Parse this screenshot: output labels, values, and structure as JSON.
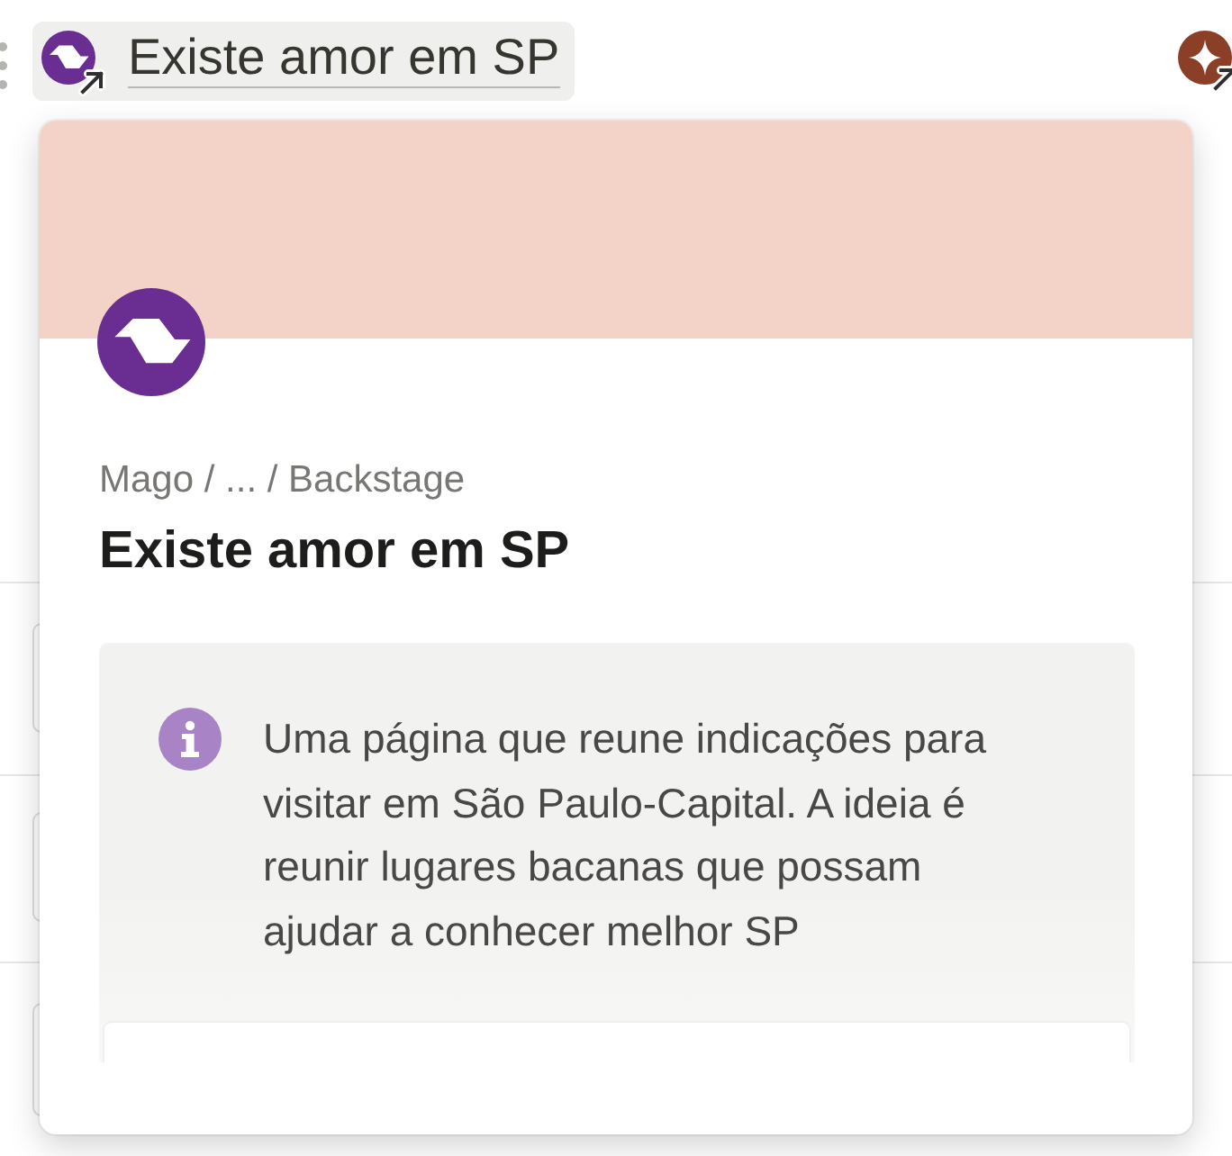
{
  "link_chip": {
    "title": "Existe amor em SP"
  },
  "hover_card": {
    "breadcrumb": "Mago / ... / Backstage",
    "title": "Existe amor em SP",
    "callout": {
      "text": "Uma página que reune indicações para visitar em São Paulo-Capital. A ideia é reunir lugares bacanas que possam ajudar a conhecer melhor SP"
    }
  }
}
